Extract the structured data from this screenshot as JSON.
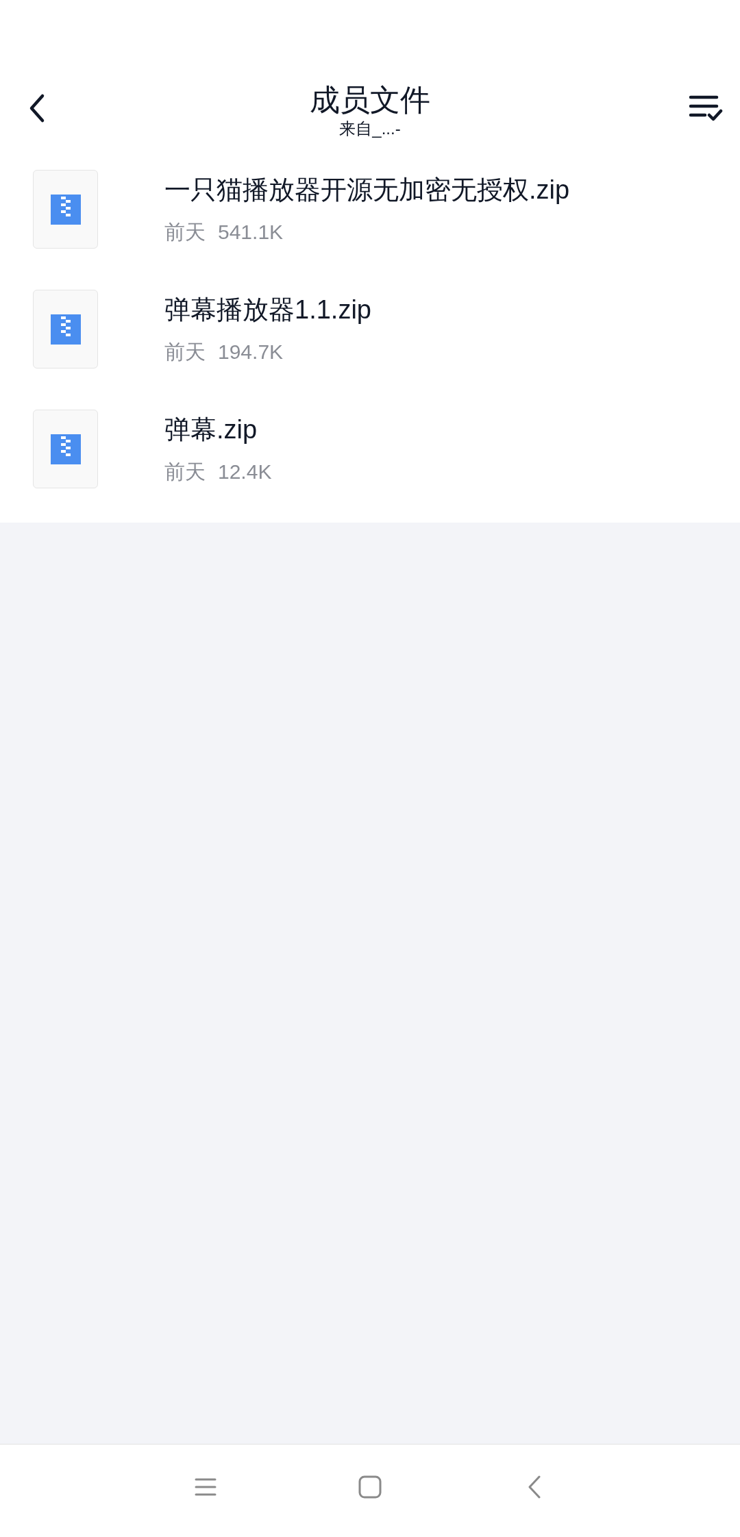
{
  "header": {
    "title": "成员文件",
    "subtitle": "来自_...-"
  },
  "files": [
    {
      "name": "一只猫播放器开源无加密无授权.zip",
      "date": "前天",
      "size": "541.1K"
    },
    {
      "name": "弹幕播放器1.1.zip",
      "date": "前天",
      "size": "194.7K"
    },
    {
      "name": "弹幕.zip",
      "date": "前天",
      "size": "12.4K"
    }
  ]
}
